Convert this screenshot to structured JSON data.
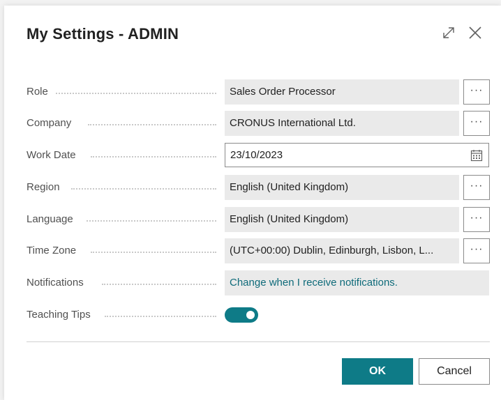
{
  "dialog": {
    "title": "My Settings - ADMIN",
    "expand_icon": "expand-diagonal-icon",
    "close_icon": "close-x-icon"
  },
  "fields": {
    "role": {
      "label": "Role",
      "value": "Sales Order Processor"
    },
    "company": {
      "label": "Company",
      "value": "CRONUS International Ltd."
    },
    "work_date": {
      "label": "Work Date",
      "value": "23/10/2023",
      "icon": "calendar-icon"
    },
    "region": {
      "label": "Region",
      "value": "English (United Kingdom)"
    },
    "language": {
      "label": "Language",
      "value": "English (United Kingdom)"
    },
    "time_zone": {
      "label": "Time Zone",
      "value": "(UTC+00:00) Dublin, Edinburgh, Lisbon, L..."
    },
    "notifications": {
      "label": "Notifications",
      "value": "Change when I receive notifications."
    },
    "teaching_tips": {
      "label": "Teaching Tips",
      "enabled": true
    }
  },
  "lookup_button": {
    "label": "···"
  },
  "buttons": {
    "ok": "OK",
    "cancel": "Cancel"
  },
  "colors": {
    "accent": "#0e7b87",
    "link": "#0f6b7a",
    "field_bg": "#eaeaea"
  }
}
